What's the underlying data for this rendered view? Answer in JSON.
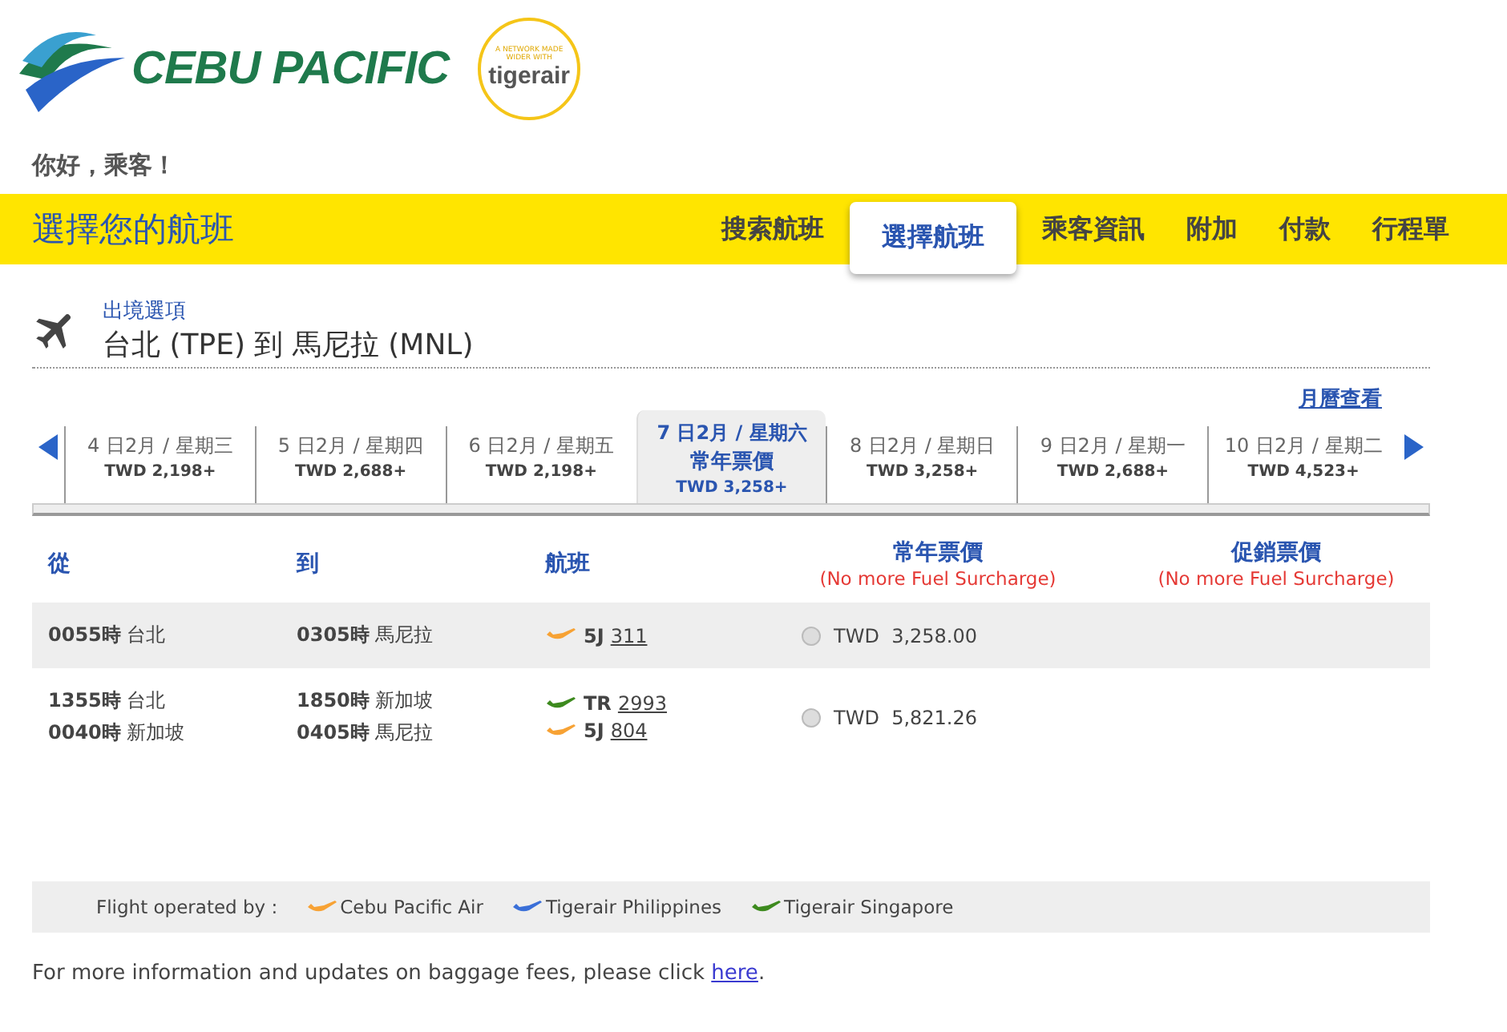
{
  "brand": {
    "name": "CEBU PACIFIC",
    "partner_tagline": "A NETWORK MADE WIDER WITH",
    "partner_name": "tigerair"
  },
  "greeting": "你好，乘客！",
  "header": {
    "title": "選擇您的航班",
    "steps": [
      {
        "label": "搜索航班",
        "selected": false
      },
      {
        "label": "選擇航班",
        "selected": true
      },
      {
        "label": "乘客資訊",
        "selected": false
      },
      {
        "label": "附加",
        "selected": false
      },
      {
        "label": "付款",
        "selected": false
      },
      {
        "label": "行程單",
        "selected": false
      }
    ]
  },
  "section": {
    "label": "出境選項",
    "route": "台北 (TPE) 到 馬尼拉 (MNL)",
    "calendar_link": "月曆查看"
  },
  "dates": [
    {
      "date": "4 日2月 / 星期三",
      "price": "TWD 2,198+",
      "selected": false
    },
    {
      "date": "5 日2月 / 星期四",
      "price": "TWD 2,688+",
      "selected": false
    },
    {
      "date": "6 日2月 / 星期五",
      "price": "TWD 2,198+",
      "selected": false
    },
    {
      "date": "7 日2月 / 星期六",
      "fare": "常年票價",
      "price": "TWD 3,258+",
      "selected": true
    },
    {
      "date": "8 日2月 / 星期日",
      "price": "TWD 3,258+",
      "selected": false
    },
    {
      "date": "9 日2月 / 星期一",
      "price": "TWD 2,688+",
      "selected": false
    },
    {
      "date": "10 日2月 / 星期二",
      "price": "TWD 4,523+",
      "selected": false
    }
  ],
  "table": {
    "columns": [
      {
        "label": "從"
      },
      {
        "label": "到"
      },
      {
        "label": "航班"
      },
      {
        "label": "常年票價",
        "note": "(No more Fuel Surcharge)"
      },
      {
        "label": "促銷票價",
        "note": "(No more Fuel Surcharge)"
      }
    ],
    "rows": [
      {
        "legs": [
          {
            "dep_time": "0055時",
            "dep_city": "台北",
            "arr_time": "0305時",
            "arr_city": "馬尼拉",
            "carrier": "5J",
            "number": "311",
            "color": "#f7a234"
          }
        ],
        "fare": {
          "price": "TWD  3,258.00",
          "selected": false
        }
      },
      {
        "legs": [
          {
            "dep_time": "1355時",
            "dep_city": "台北",
            "arr_time": "1850時",
            "arr_city": "新加坡",
            "carrier": "TR",
            "number": "2993",
            "color": "#3d8a1e"
          },
          {
            "dep_time": "0040時",
            "dep_city": "新加坡",
            "arr_time": "0405時",
            "arr_city": "馬尼拉",
            "carrier": "5J",
            "number": "804",
            "color": "#f7a234"
          }
        ],
        "fare": {
          "price": "TWD  5,821.26",
          "selected": false
        }
      }
    ]
  },
  "legend": {
    "label": "Flight operated by :",
    "items": [
      {
        "name": "Cebu Pacific Air",
        "color": "#f7a234"
      },
      {
        "name": "Tigerair Philippines",
        "color": "#3a6fd8"
      },
      {
        "name": "Tigerair Singapore",
        "color": "#3d8a1e"
      }
    ]
  },
  "footer": {
    "text": "For more information and updates on baggage fees, please click ",
    "link": "here",
    "end": "."
  }
}
